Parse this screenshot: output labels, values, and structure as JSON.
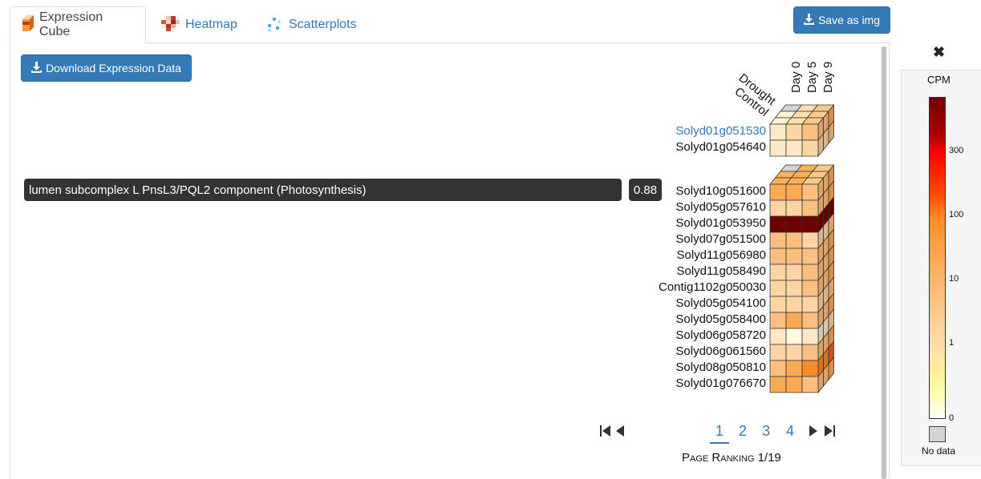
{
  "tabs": [
    {
      "label": "Expression Cube",
      "active": true,
      "icon": "cube-icon"
    },
    {
      "label": "Heatmap",
      "active": false,
      "icon": "heatmap-icon"
    },
    {
      "label": "Scatterplots",
      "active": false,
      "icon": "scatter-icon"
    }
  ],
  "save_button": "Save as img",
  "download_button": "Download Expression Data",
  "function_label": "lumen subcomplex L PnsL3/PQL2 component (Photosynthesis)",
  "score": "0.88",
  "column_labels": [
    "Day 0",
    "Day 5",
    "Day 9"
  ],
  "depth_labels": [
    "Drought",
    "Control"
  ],
  "query_genes": [
    {
      "id": "Solyd01g051530",
      "highlight": true,
      "levels": [
        1,
        2,
        3
      ]
    },
    {
      "id": "Solyd01g054640",
      "highlight": false,
      "levels": [
        1,
        1,
        2
      ]
    }
  ],
  "genes": [
    {
      "id": "Solyd10g051600",
      "levels": [
        4,
        4,
        3
      ]
    },
    {
      "id": "Solyd05g057610",
      "levels": [
        2,
        2,
        3
      ]
    },
    {
      "id": "Solyd01g053950",
      "levels": [
        9,
        9,
        9
      ]
    },
    {
      "id": "Solyd07g051500",
      "levels": [
        3,
        3,
        2
      ]
    },
    {
      "id": "Solyd11g056980",
      "levels": [
        3,
        3,
        3
      ]
    },
    {
      "id": "Solyd11g058490",
      "levels": [
        2,
        2,
        3
      ]
    },
    {
      "id": "Contig1102g050030",
      "levels": [
        2,
        2,
        3
      ]
    },
    {
      "id": "Solyd05g054100",
      "levels": [
        2,
        2,
        2
      ]
    },
    {
      "id": "Solyd05g058400",
      "levels": [
        3,
        4,
        3
      ]
    },
    {
      "id": "Solyd06g058720",
      "levels": [
        1,
        0,
        1
      ]
    },
    {
      "id": "Solyd06g061560",
      "levels": [
        2,
        2,
        3
      ]
    },
    {
      "id": "Solyd08g050810",
      "levels": [
        3,
        4,
        5
      ]
    },
    {
      "id": "Solyd01g076670",
      "levels": [
        4,
        4,
        3
      ]
    }
  ],
  "pagination": {
    "pages": [
      "1",
      "2",
      "3",
      "4"
    ],
    "current": "1",
    "ranking": "Page Ranking 1/19"
  },
  "legend": {
    "title": "CPM",
    "ticks": [
      "300",
      "100",
      "10",
      "1",
      "0"
    ],
    "no_data": "No data",
    "close_icon": "close-icon"
  },
  "colors": {
    "primary": "#337ab7",
    "palette": [
      "#fffde0",
      "#fde9c8",
      "#fdd4a4",
      "#fdbf80",
      "#fca954",
      "#f98a2c",
      "#f46020",
      "#e02015",
      "#a00808",
      "#700000"
    ]
  }
}
